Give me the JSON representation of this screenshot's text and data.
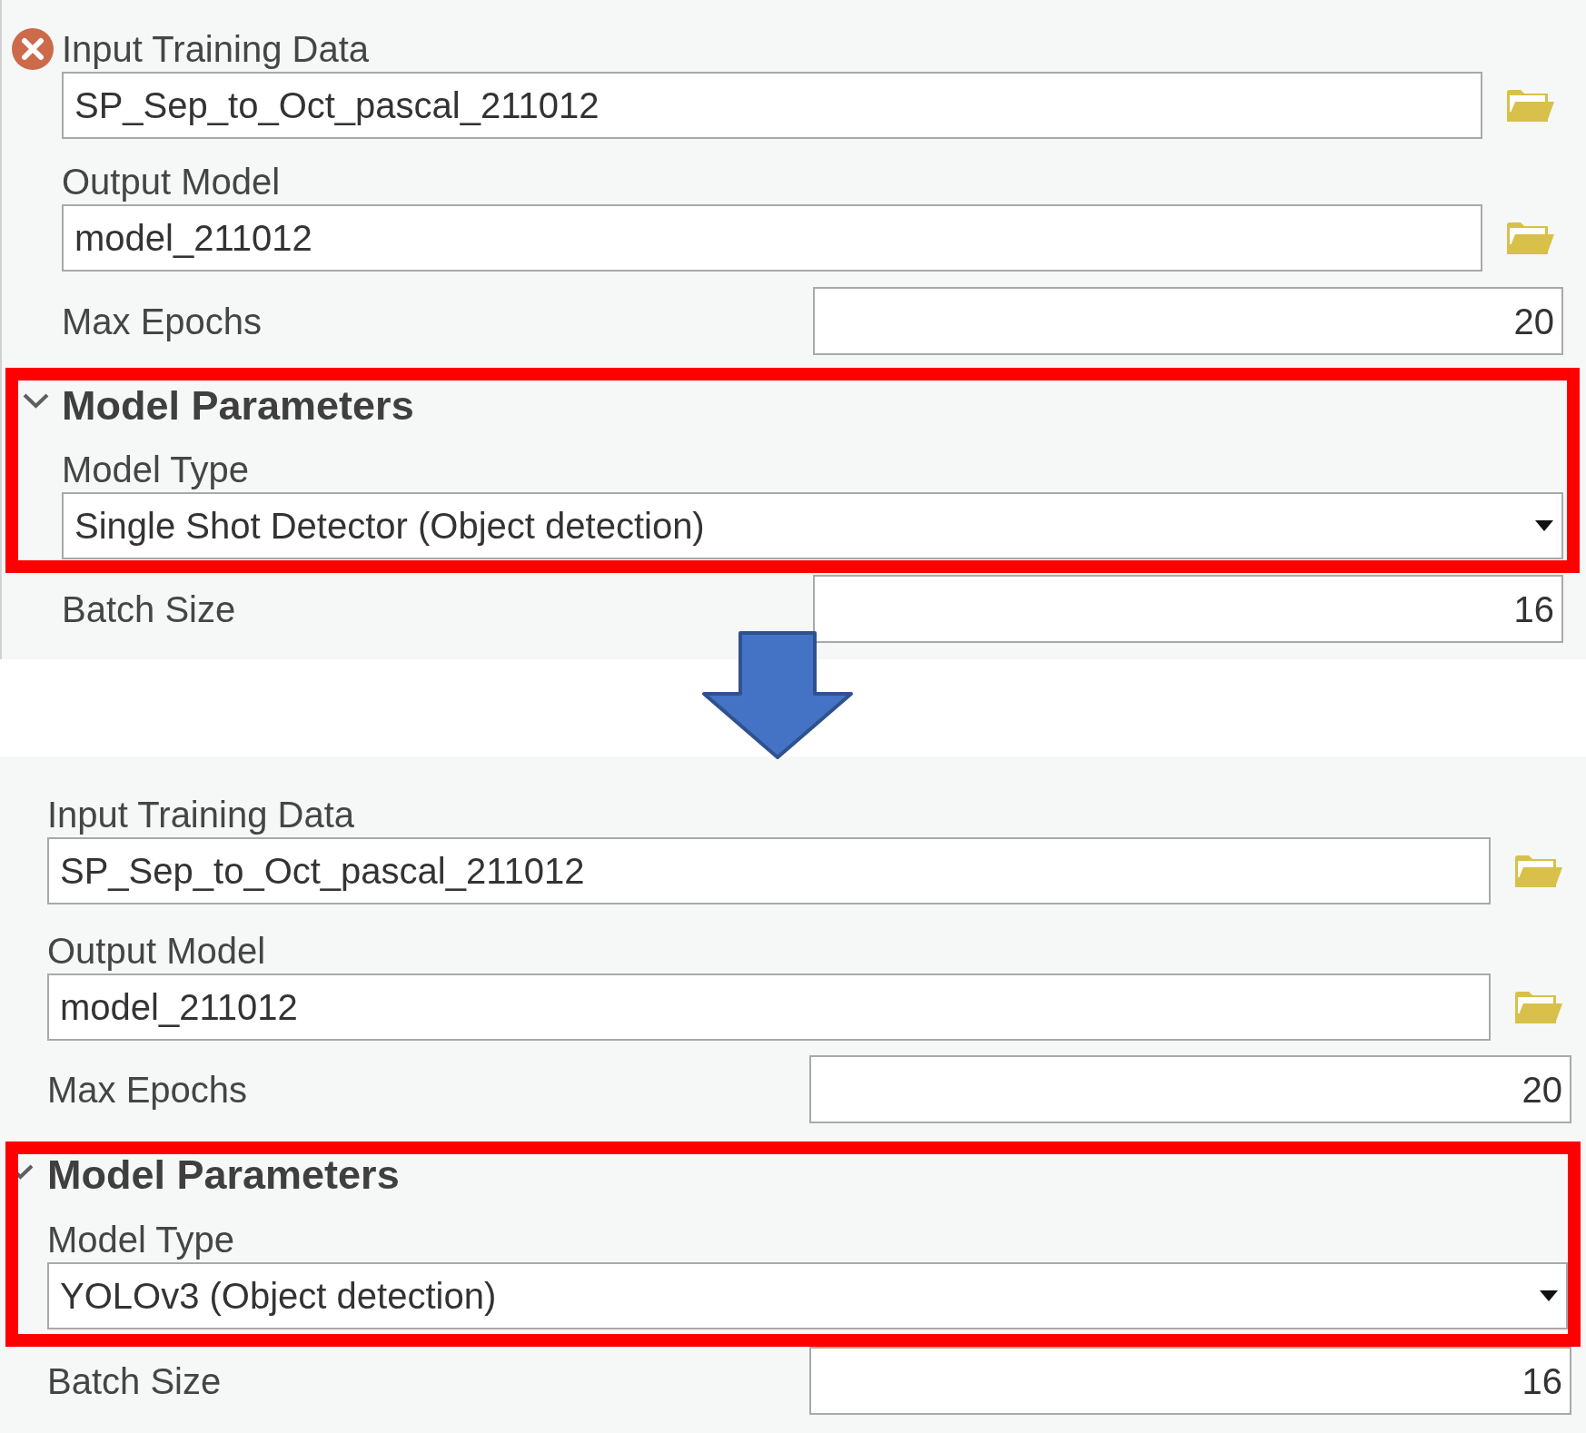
{
  "panels": [
    {
      "rows": [
        {
          "kind": "path",
          "label": "Input Training Data",
          "value": "SP_Sep_to_Oct_pascal_211012",
          "error": true,
          "highlighted": false
        },
        {
          "kind": "path",
          "label": "Output Model",
          "value": "model_211012",
          "error": false,
          "highlighted": false
        },
        {
          "kind": "number",
          "label": "Max Epochs",
          "value": "20",
          "error": false,
          "highlighted": false
        },
        {
          "kind": "section",
          "title": "Model Parameters",
          "expanded": true,
          "highlighted": true
        },
        {
          "kind": "dropdown",
          "label": "Model Type",
          "value": "Single Shot Detector (Object detection)",
          "error": false,
          "highlighted": true
        },
        {
          "kind": "number",
          "label": "Batch Size",
          "value": "16",
          "error": false,
          "highlighted": false
        }
      ]
    },
    {
      "rows": [
        {
          "kind": "path",
          "label": "Input Training Data",
          "value": "SP_Sep_to_Oct_pascal_211012",
          "error": false,
          "highlighted": false
        },
        {
          "kind": "path",
          "label": "Output Model",
          "value": "model_211012",
          "error": false,
          "highlighted": false
        },
        {
          "kind": "number",
          "label": "Max Epochs",
          "value": "20",
          "error": false,
          "highlighted": false
        },
        {
          "kind": "section",
          "title": "Model Parameters",
          "expanded": true,
          "highlighted": true
        },
        {
          "kind": "dropdown",
          "label": "Model Type",
          "value": "YOLOv3 (Object detection)",
          "error": false,
          "highlighted": true
        },
        {
          "kind": "number",
          "label": "Batch Size",
          "value": "16",
          "error": false,
          "highlighted": false
        }
      ]
    }
  ]
}
